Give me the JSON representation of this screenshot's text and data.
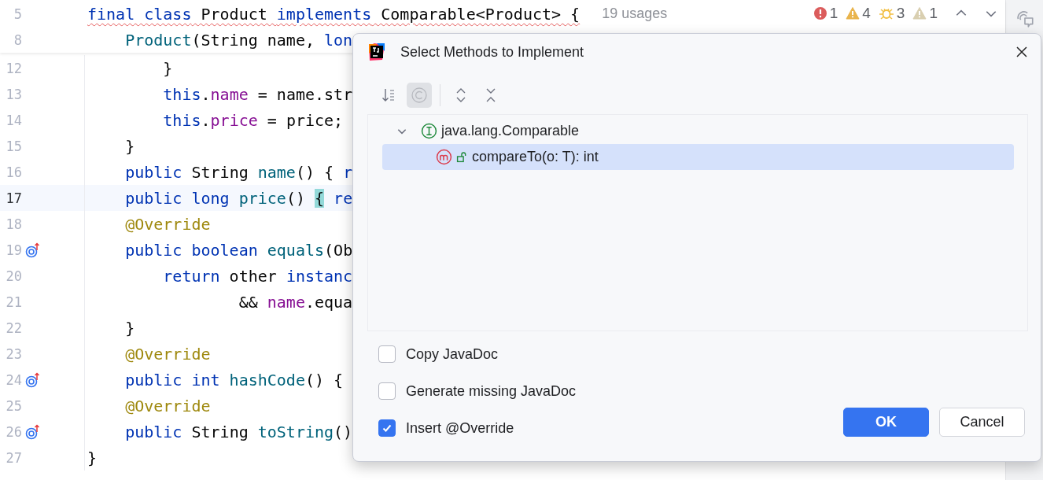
{
  "editor": {
    "sticky_lines": [
      {
        "number": "5",
        "tokens": [
          {
            "t": "final class",
            "kind": "kw"
          },
          {
            "t": " Product ",
            "kind": "plain"
          },
          {
            "t": "implements",
            "kind": "kw"
          },
          {
            "t": " Comparable<Product> {",
            "kind": "plain"
          }
        ],
        "hint": "19 usages",
        "error_underline": true
      },
      {
        "number": "8",
        "tokens": [
          {
            "t": "    Product",
            "kind": "fn"
          },
          {
            "t": "(String name, ",
            "kind": "plain"
          },
          {
            "t": "lon",
            "kind": "kw"
          }
        ],
        "error_underline": false
      }
    ],
    "lines": [
      {
        "number": "12",
        "tokens": [
          {
            "t": "        }",
            "kind": "plain"
          }
        ],
        "current": false,
        "overrides": false
      },
      {
        "number": "13",
        "tokens": [
          {
            "t": "        this",
            "kind": "kw"
          },
          {
            "t": ".",
            "kind": "plain"
          },
          {
            "t": "name",
            "kind": "field"
          },
          {
            "t": " = name.str",
            "kind": "plain"
          }
        ],
        "current": false,
        "overrides": false
      },
      {
        "number": "14",
        "tokens": [
          {
            "t": "        this",
            "kind": "kw"
          },
          {
            "t": ".",
            "kind": "plain"
          },
          {
            "t": "price",
            "kind": "field"
          },
          {
            "t": " = price;",
            "kind": "plain"
          }
        ],
        "current": false,
        "overrides": false
      },
      {
        "number": "15",
        "tokens": [
          {
            "t": "    }",
            "kind": "plain"
          }
        ],
        "current": false,
        "overrides": false
      },
      {
        "number": "16",
        "tokens": [
          {
            "t": "    public",
            "kind": "kw"
          },
          {
            "t": " String ",
            "kind": "plain"
          },
          {
            "t": "name",
            "kind": "fn"
          },
          {
            "t": "() { ",
            "kind": "plain"
          },
          {
            "t": "r",
            "kind": "kw"
          }
        ],
        "current": false,
        "overrides": false
      },
      {
        "number": "17",
        "tokens": [
          {
            "t": "    public long",
            "kind": "kw"
          },
          {
            "t": " price",
            "kind": "fn"
          },
          {
            "t": "() ",
            "kind": "plain"
          },
          {
            "t": "{",
            "kind": "brace"
          },
          {
            "t": " re",
            "kind": "kw"
          }
        ],
        "current": true,
        "overrides": false
      },
      {
        "number": "18",
        "tokens": [
          {
            "t": "    @Override",
            "kind": "ann"
          }
        ],
        "current": false,
        "overrides": false
      },
      {
        "number": "19",
        "tokens": [
          {
            "t": "    public boolean",
            "kind": "kw"
          },
          {
            "t": " equals",
            "kind": "fn"
          },
          {
            "t": "(Ob",
            "kind": "plain"
          }
        ],
        "current": false,
        "overrides": true
      },
      {
        "number": "20",
        "tokens": [
          {
            "t": "        return",
            "kind": "kw"
          },
          {
            "t": " other ",
            "kind": "plain"
          },
          {
            "t": "instanc",
            "kind": "kw"
          }
        ],
        "current": false,
        "overrides": false
      },
      {
        "number": "21",
        "tokens": [
          {
            "t": "                && ",
            "kind": "plain"
          },
          {
            "t": "name",
            "kind": "field"
          },
          {
            "t": ".equa",
            "kind": "plain"
          }
        ],
        "current": false,
        "overrides": false
      },
      {
        "number": "22",
        "tokens": [
          {
            "t": "    }",
            "kind": "plain"
          }
        ],
        "current": false,
        "overrides": false
      },
      {
        "number": "23",
        "tokens": [
          {
            "t": "    @Override",
            "kind": "ann"
          }
        ],
        "current": false,
        "overrides": false
      },
      {
        "number": "24",
        "tokens": [
          {
            "t": "    public int",
            "kind": "kw"
          },
          {
            "t": " hashCode",
            "kind": "fn"
          },
          {
            "t": "() {",
            "kind": "plain"
          }
        ],
        "current": false,
        "overrides": true
      },
      {
        "number": "25",
        "tokens": [
          {
            "t": "    @Override",
            "kind": "ann"
          }
        ],
        "current": false,
        "overrides": false
      },
      {
        "number": "26",
        "tokens": [
          {
            "t": "    public",
            "kind": "kw"
          },
          {
            "t": " String ",
            "kind": "plain"
          },
          {
            "t": "toString",
            "kind": "fn"
          },
          {
            "t": "()",
            "kind": "plain"
          }
        ],
        "current": false,
        "overrides": true
      },
      {
        "number": "27",
        "tokens": [
          {
            "t": "}",
            "kind": "plain"
          }
        ],
        "current": false,
        "overrides": false
      }
    ]
  },
  "inspections": [
    {
      "kind": "error",
      "count": "1"
    },
    {
      "kind": "warning",
      "count": "4"
    },
    {
      "kind": "weak",
      "count": "3"
    },
    {
      "kind": "typo",
      "count": "1"
    }
  ],
  "dialog": {
    "title": "Select Methods to Implement",
    "toolbar": {
      "sort_alphabetically": {
        "selected": false
      },
      "show_classes": {
        "selected": true
      }
    },
    "tree": [
      {
        "label": "java.lang.Comparable",
        "kind": "interface",
        "expanded": true,
        "selected": false,
        "children": [
          {
            "label": "compareTo(o: T): int",
            "kind": "method",
            "selected": true
          }
        ]
      }
    ],
    "options": [
      {
        "label": "Copy JavaDoc",
        "checked": false
      },
      {
        "label": "Generate missing JavaDoc",
        "checked": false
      },
      {
        "label": "Insert @Override",
        "checked": true
      }
    ],
    "buttons": [
      {
        "label": "OK",
        "kind": "primary"
      },
      {
        "label": "Cancel",
        "kind": "secondary"
      }
    ]
  }
}
